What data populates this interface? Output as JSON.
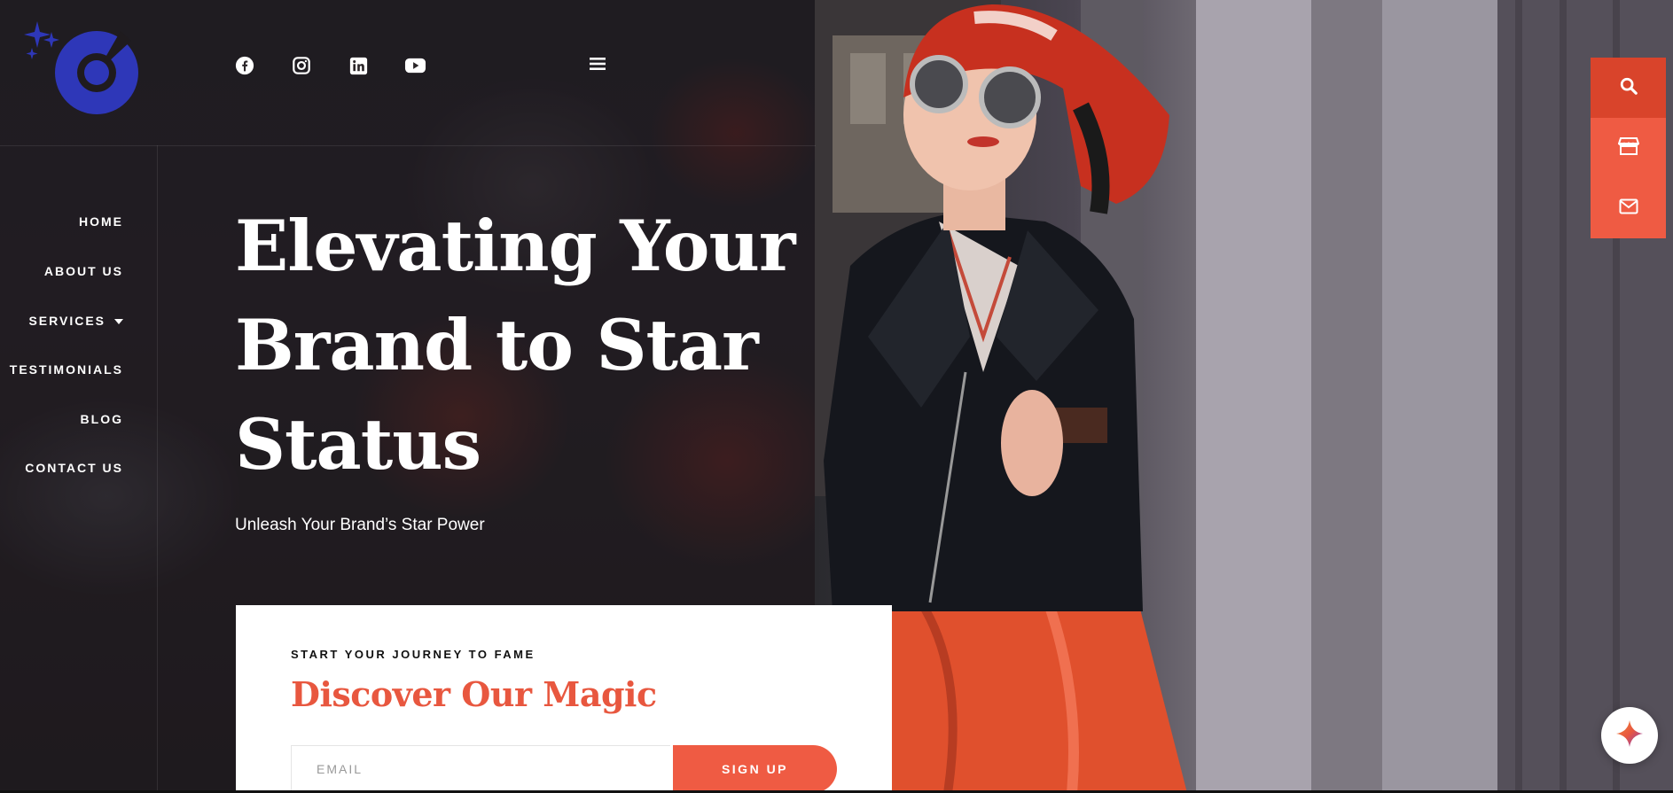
{
  "brand": {
    "logo_icon": "comet-star-logo",
    "accent": "#ef5b43",
    "logo_color": "#2e37b8"
  },
  "header": {
    "social": [
      {
        "name": "facebook-icon"
      },
      {
        "name": "instagram-icon"
      },
      {
        "name": "linkedin-icon"
      },
      {
        "name": "youtube-icon"
      }
    ],
    "menu_icon": "hamburger-icon"
  },
  "nav": {
    "items": [
      {
        "label": "HOME"
      },
      {
        "label": "ABOUT US"
      },
      {
        "label": "SERVICES"
      },
      {
        "label": "TESTIMONIALS"
      },
      {
        "label": "BLOG"
      },
      {
        "label": "CONTACT US"
      }
    ]
  },
  "hero": {
    "title_lines": [
      "Elevating Your",
      "Brand to Star",
      "Status"
    ],
    "subtitle": "Unleash Your Brand’s Star Power"
  },
  "signup_card": {
    "eyebrow": "START YOUR JOURNEY TO FAME",
    "title": "Discover Our Magic",
    "email_placeholder": "EMAIL",
    "button_label": "SIGN UP"
  },
  "side_tools": [
    {
      "name": "search-icon"
    },
    {
      "name": "store-icon"
    },
    {
      "name": "mail-icon"
    }
  ],
  "fab_icon": "sparkle-icon"
}
